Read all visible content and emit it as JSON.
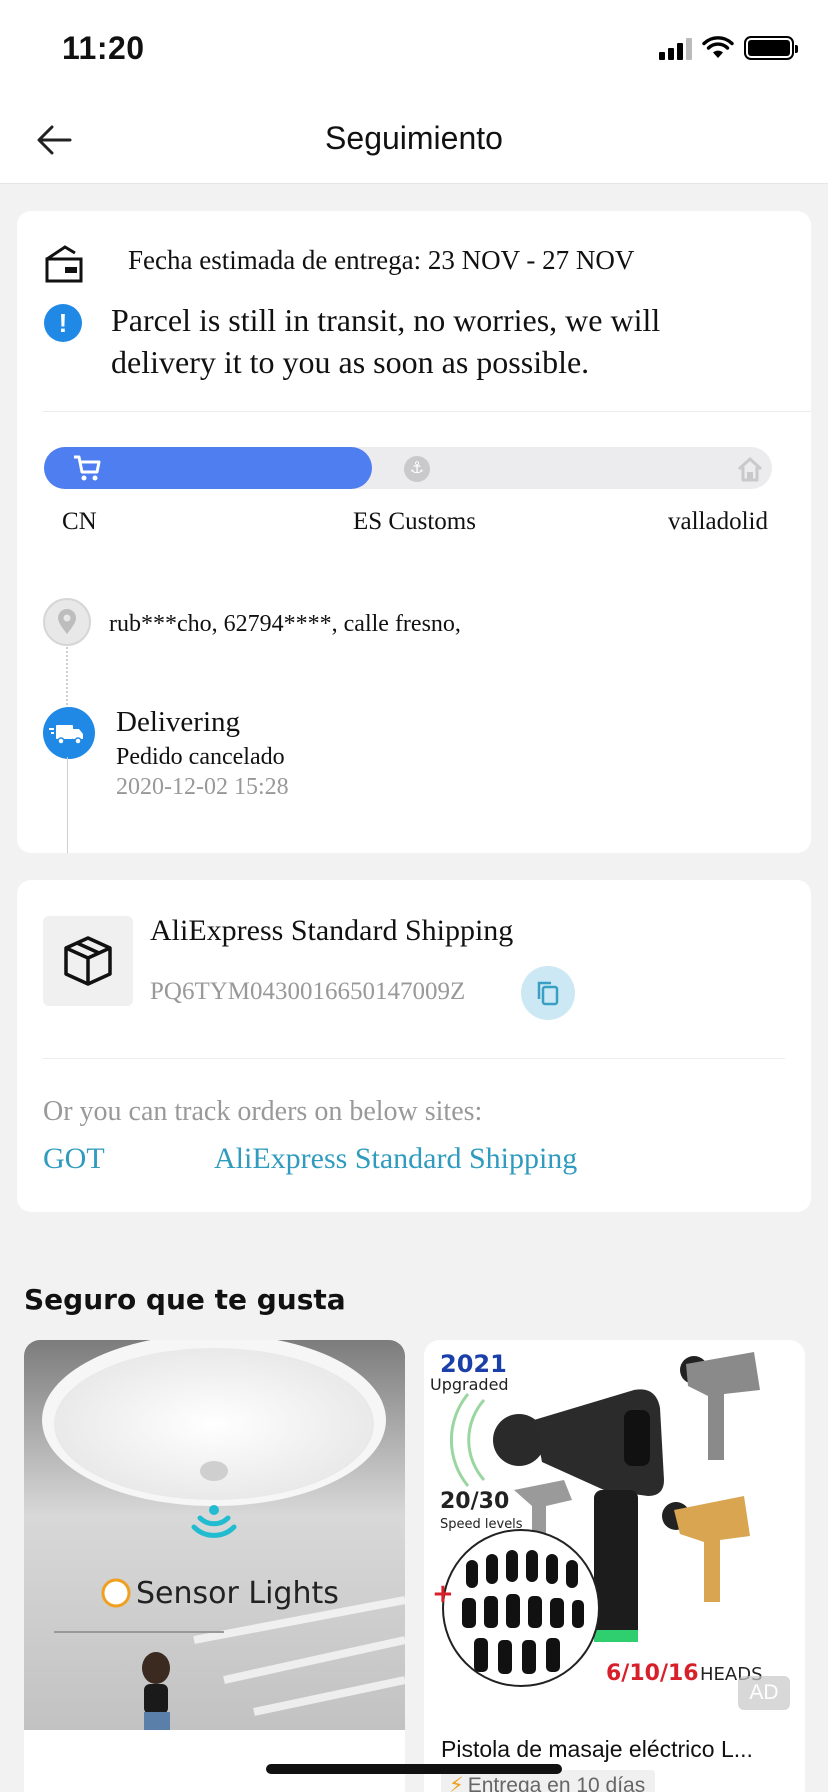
{
  "status_bar": {
    "time": "11:20"
  },
  "header": {
    "title": "Seguimiento"
  },
  "tracking": {
    "estimated_delivery": "Fecha estimada de entrega: 23 NOV - 27 NOV",
    "notice": "Parcel is still in transit, no worries, we will delivery it to you as soon as possible.",
    "progress_fraction": 0.45,
    "stages": [
      "CN",
      "ES Customs",
      "valladolid"
    ],
    "address": "rub***cho,  62794****,  calle fresno,",
    "event": {
      "title": "Delivering",
      "subtitle": "Pedido cancelado",
      "time": "2020-12-02 15:28"
    }
  },
  "shipping": {
    "carrier": "AliExpress Standard Shipping",
    "tracking_number": "PQ6TYM0430016650147009Z",
    "hint": "Or you can track orders on below sites:",
    "sites": [
      "GOT",
      "AliExpress Standard Shipping"
    ]
  },
  "recommendations": {
    "title": "Seguro que te gusta",
    "products": [
      {
        "image_text": "Sensor Lights"
      },
      {
        "image_text": [
          "2021",
          "Upgraded",
          "20/30",
          "Speed  levels",
          "6/10/16",
          "HEADS"
        ],
        "title": "Pistola de masaje eléctrico L...",
        "delivery": "Entrega en 10 días",
        "ad": "AD"
      }
    ]
  },
  "colors": {
    "accent_blue": "#4f7ef0",
    "info_blue": "#1f89e5",
    "link": "#2f9bbf"
  }
}
